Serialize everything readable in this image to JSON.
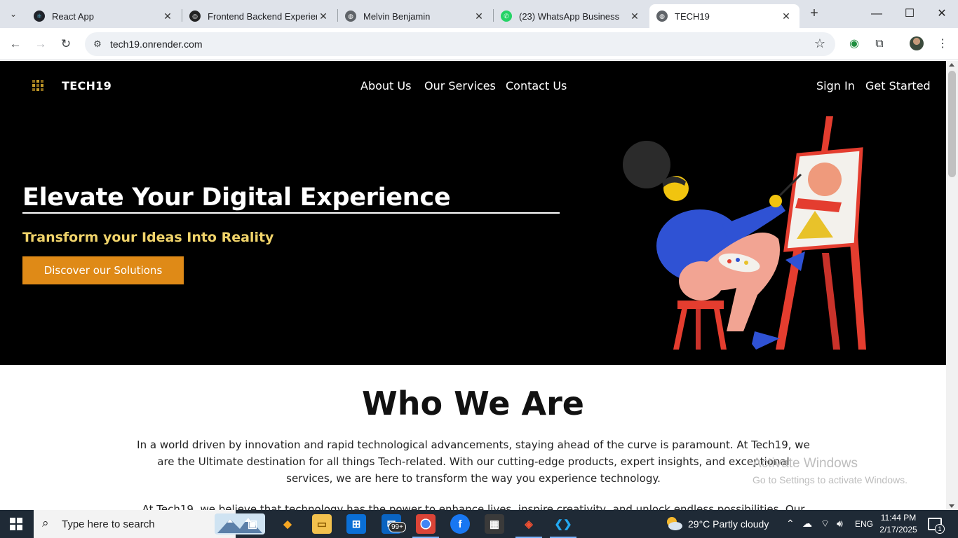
{
  "browser": {
    "tabs": [
      {
        "title": "React App",
        "icon": "react-icon",
        "active": false
      },
      {
        "title": "Frontend Backend Experienc",
        "icon": "openai-icon",
        "active": false
      },
      {
        "title": "Melvin Benjamin",
        "icon": "globe-icon",
        "active": false
      },
      {
        "title": "(23) WhatsApp Business",
        "icon": "whatsapp-icon",
        "active": false
      },
      {
        "title": "TECH19",
        "icon": "globe-icon",
        "active": true
      }
    ],
    "url": "tech19.onrender.com"
  },
  "site": {
    "brand": "TECH19",
    "nav": {
      "about": "About Us",
      "services": "Our Services",
      "contact": "Contact Us",
      "signin": "Sign In",
      "get_started": "Get Started"
    },
    "hero": {
      "title": "Elevate Your Digital Experience",
      "subtitle": "Transform your Ideas Into Reality",
      "cta": "Discover our Solutions"
    },
    "who": {
      "title": "Who We Are",
      "p1": "In a world driven by innovation and rapid technological advancements, staying ahead of the curve is paramount. At Tech19, we are the Ultimate destination for all things Tech-related. With our cutting-edge products, expert insights, and exceptional services, we are here to transform the way you experience technology.",
      "p2": "At Tech19, we believe that technology has the power to enhance lives, inspire creativity, and unlock endless possibilities. Our"
    },
    "colors": {
      "hero_bg": "#000000",
      "subtitle": "#f0d36a",
      "cta": "#df8a17"
    }
  },
  "watermark": {
    "line1": "Activate Windows",
    "line2": "Go to Settings to activate Windows."
  },
  "taskbar": {
    "search_placeholder": "Type here to search",
    "mail_badge": "99+",
    "weather": "29°C  Partly cloudy",
    "language": "ENG",
    "time": "11:44 PM",
    "date": "2/17/2025",
    "notification_count": "1"
  }
}
